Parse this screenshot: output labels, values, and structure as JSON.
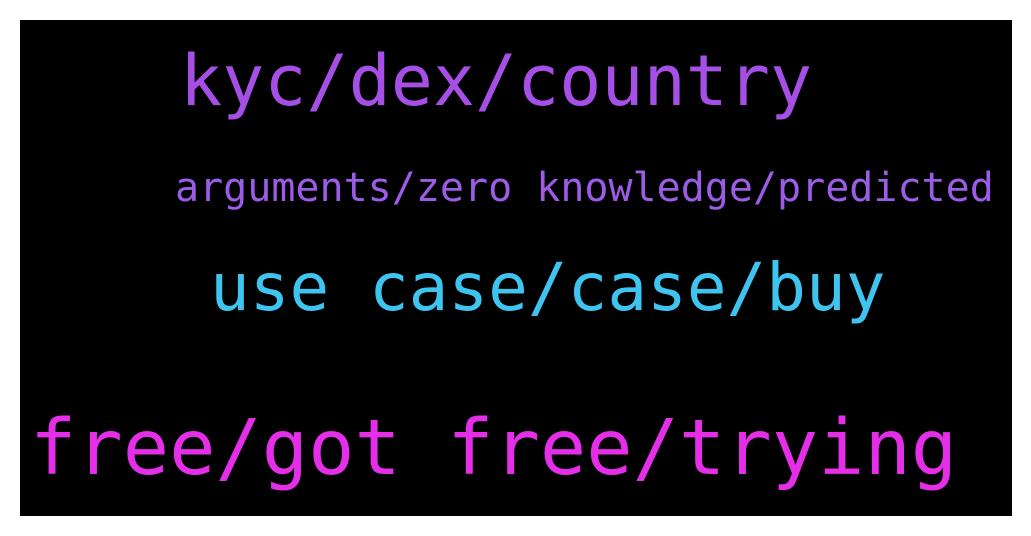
{
  "words": [
    {
      "text": "kyc/dex/country",
      "color": "#a64fe6"
    },
    {
      "text": "arguments/zero knowledge/predicted",
      "color": "#9b5ce6"
    },
    {
      "text": "use case/case/buy",
      "color": "#3ec4ee"
    },
    {
      "text": "free/got free/trying",
      "color": "#e42ee8"
    }
  ]
}
